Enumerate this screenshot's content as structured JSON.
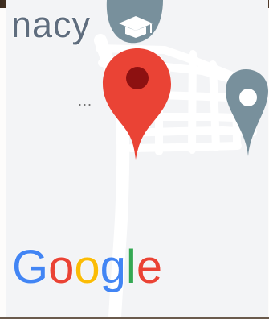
{
  "map": {
    "place_label_partial": "nacy",
    "ellipsis": "...",
    "attribution": [
      "G",
      "o",
      "o",
      "g",
      "l",
      "e"
    ],
    "colors": {
      "background": "#f3f4f6",
      "roads": "#ffffff",
      "selected_pin": "#ea4335",
      "selected_pin_dot": "#8d1111",
      "school_marker": "#78909c",
      "poi_marker": "#78909c",
      "logo": [
        "#4285f4",
        "#ea4335",
        "#fbbc05",
        "#4285f4",
        "#34a853",
        "#ea4335"
      ]
    },
    "icons": {
      "selected": "map-pin-icon",
      "school": "graduation-cap-icon",
      "poi": "map-pin-icon"
    }
  }
}
